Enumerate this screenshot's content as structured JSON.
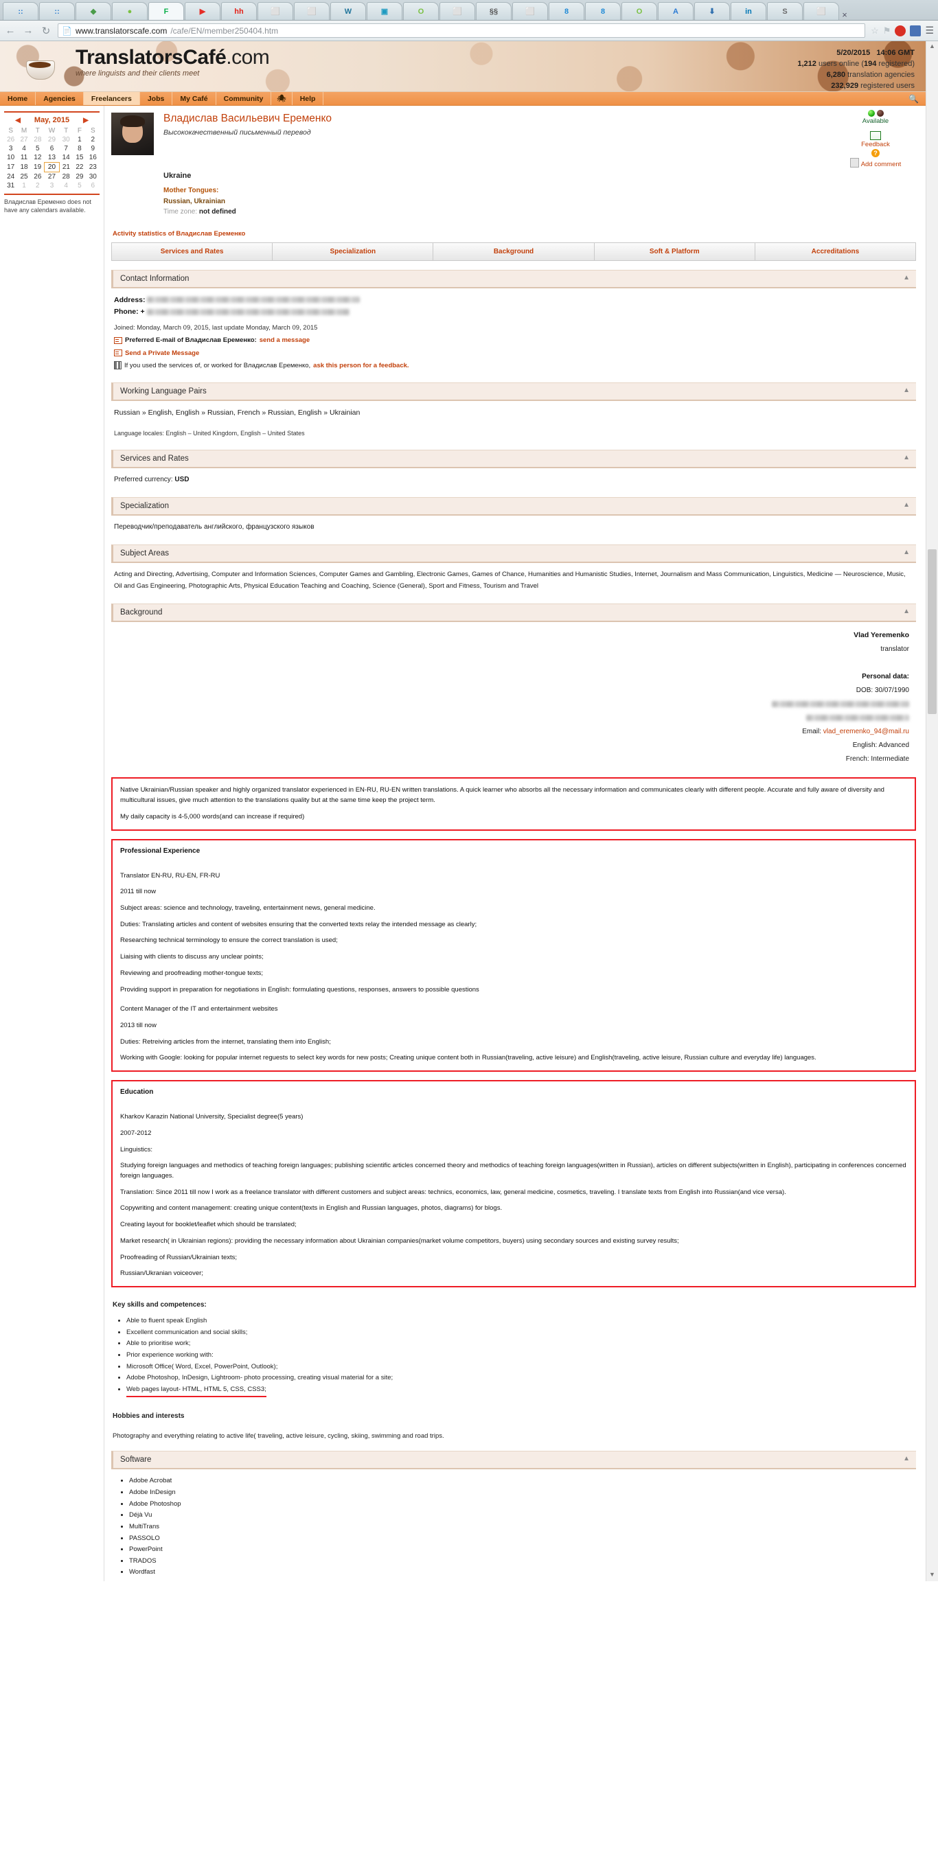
{
  "browser": {
    "url_prefix": "www.translatorscafe.com",
    "url_suffix": "/cafe/EN/member250404.htm",
    "back_icon": "back-arrow-icon",
    "forward_icon": "forward-arrow-icon",
    "reload_icon": "reload-icon",
    "tabs": [
      {
        "glyph": "::",
        "color": "#2f7fd0"
      },
      {
        "glyph": "::",
        "color": "#2f7fd0"
      },
      {
        "glyph": "◆",
        "color": "#4a9c4a"
      },
      {
        "glyph": "●",
        "color": "#7ac143"
      },
      {
        "glyph": "F",
        "color": "#0bb04b"
      },
      {
        "glyph": "▶",
        "color": "#e52d27"
      },
      {
        "glyph": "hh",
        "color": "#e2231a"
      },
      {
        "glyph": "⬜",
        "color": "#9aa7ad"
      },
      {
        "glyph": "⬜",
        "color": "#9aa7ad"
      },
      {
        "glyph": "W",
        "color": "#21759b"
      },
      {
        "glyph": "▣",
        "color": "#1f9bc1"
      },
      {
        "glyph": "O",
        "color": "#7ac143"
      },
      {
        "glyph": "⬜",
        "color": "#9aa7ad"
      },
      {
        "glyph": "§§",
        "color": "#555555"
      },
      {
        "glyph": "⬜",
        "color": "#9aa7ad"
      },
      {
        "glyph": "8",
        "color": "#1f8ad6"
      },
      {
        "glyph": "8",
        "color": "#1f8ad6"
      },
      {
        "glyph": "O",
        "color": "#7ac143"
      },
      {
        "glyph": "A",
        "color": "#2b7bd4"
      },
      {
        "glyph": "⬇",
        "color": "#2f6fae"
      },
      {
        "glyph": "in",
        "color": "#0077b5"
      },
      {
        "glyph": "S",
        "color": "#6a6a6a"
      },
      {
        "glyph": "⬜",
        "color": "#9aa7ad"
      }
    ]
  },
  "site": {
    "logo_main": "TranslatorsCafé",
    "logo_dotcom": ".com",
    "logo_sub": "where linguists and their clients meet",
    "stats": {
      "date": "5/20/2015",
      "time": "14:06 GMT",
      "users_online_count": "1,212",
      "users_online_text": "users online (",
      "registered_count": "194",
      "registered_text": "registered)",
      "agencies_count": "6,280",
      "agencies_text": "translation agencies",
      "members_count": "232,929",
      "members_text": "registered users"
    },
    "nav": [
      {
        "label": "Home",
        "selected": false
      },
      {
        "label": "Agencies",
        "selected": false
      },
      {
        "label": "Freelancers",
        "selected": true
      },
      {
        "label": "Jobs",
        "selected": false
      },
      {
        "label": "My Café",
        "selected": false
      },
      {
        "label": "Community",
        "selected": false
      },
      {
        "label": "Help",
        "selected": false
      }
    ],
    "nav_spider_icon": "spider-icon",
    "search_icon": "search-icon"
  },
  "calendar": {
    "month_label": "May, 2015",
    "prev_icon": "prev-month-arrow",
    "next_icon": "next-month-arrow",
    "weekdays": [
      "S",
      "M",
      "T",
      "W",
      "T",
      "F",
      "S"
    ],
    "weeks": [
      [
        {
          "d": "26",
          "o": true
        },
        {
          "d": "27",
          "o": true
        },
        {
          "d": "28",
          "o": true
        },
        {
          "d": "29",
          "o": true
        },
        {
          "d": "30",
          "o": true
        },
        {
          "d": "1"
        },
        {
          "d": "2"
        }
      ],
      [
        {
          "d": "3"
        },
        {
          "d": "4"
        },
        {
          "d": "5"
        },
        {
          "d": "6"
        },
        {
          "d": "7"
        },
        {
          "d": "8"
        },
        {
          "d": "9"
        }
      ],
      [
        {
          "d": "10"
        },
        {
          "d": "11"
        },
        {
          "d": "12"
        },
        {
          "d": "13"
        },
        {
          "d": "14"
        },
        {
          "d": "15"
        },
        {
          "d": "16"
        }
      ],
      [
        {
          "d": "17"
        },
        {
          "d": "18"
        },
        {
          "d": "19"
        },
        {
          "d": "20",
          "today": true
        },
        {
          "d": "21"
        },
        {
          "d": "22"
        },
        {
          "d": "23"
        }
      ],
      [
        {
          "d": "24"
        },
        {
          "d": "25"
        },
        {
          "d": "26"
        },
        {
          "d": "27"
        },
        {
          "d": "28"
        },
        {
          "d": "29"
        },
        {
          "d": "30"
        }
      ],
      [
        {
          "d": "31"
        },
        {
          "d": "1",
          "o": true
        },
        {
          "d": "2",
          "o": true
        },
        {
          "d": "3",
          "o": true
        },
        {
          "d": "4",
          "o": true
        },
        {
          "d": "5",
          "o": true
        },
        {
          "d": "6",
          "o": true
        }
      ]
    ],
    "note": "Владислав Еременко does not have any calendars available."
  },
  "profile": {
    "name": "Владислав Васильевич Еременко",
    "tagline": "Высококачественный письменный перевод",
    "country": "Ukraine",
    "mother_tongues_label": "Mother Tongues:",
    "mother_tongues_value": "Russian, Ukrainian",
    "timezone_label": "Time zone:",
    "timezone_value": "not defined",
    "avatar_icon": "profile-photo",
    "status_label": "Available",
    "feedback_label": "Feedback",
    "add_comment_label": "Add comment",
    "activity_stats": "Activity statistics of Владислав Еременко"
  },
  "tabs": [
    {
      "label": "Services and Rates"
    },
    {
      "label": "Specialization"
    },
    {
      "label": "Background"
    },
    {
      "label": "Soft & Platform"
    },
    {
      "label": "Accreditations"
    }
  ],
  "contact": {
    "panel_title": "Contact Information",
    "address_label": "Address:",
    "phone_label": "Phone: +",
    "joined": "Joined: Monday, March 09, 2015, last update Monday, March 09, 2015",
    "preferred_email_text": "Preferred E-mail of Владислав Еременко:",
    "send_message_link": "send a message",
    "private_message_link": "Send a Private Message",
    "feedback_text": "If you used the services of, or worked for Владислав Еременко,",
    "feedback_link": "ask this person for a feedback."
  },
  "language_pairs": {
    "panel_title": "Working Language Pairs",
    "pairs": "Russian » English, English » Russian, French » Russian, English » Ukrainian",
    "locales": "Language locales: English – United Kingdom, English – United States"
  },
  "services": {
    "panel_title": "Services and Rates",
    "currency_label": "Preferred currency:",
    "currency_value": "USD"
  },
  "specialization": {
    "panel_title": "Specialization",
    "text": "Переводчик/преподаватель английского, французского языков"
  },
  "subject_areas": {
    "panel_title": "Subject Areas",
    "text": "Acting and Directing, Advertising, Computer and Information Sciences, Computer Games and Gambling, Electronic Games, Games of Chance, Humanities and Humanistic Studies, Internet, Journalism and Mass Communication, Linguistics, Medicine — Neuroscience, Music, Oil and Gas Engineering, Photographic Arts, Physical Education Teaching and Coaching, Science (General), Sport and Fitness, Tourism and Travel"
  },
  "background": {
    "panel_title": "Background",
    "name": "Vlad Yeremenko",
    "role": "translator",
    "personal_data_label": "Personal data:",
    "dob": "DOB: 30/07/1990",
    "email_label": "Email:",
    "email_value": "vlad_eremenko_94@mail.ru",
    "english_level": "English: Advanced",
    "french_level": "French: Intermediate"
  },
  "summary": {
    "para1": "Native Ukrainian/Russian speaker and highly organized translator experienced in EN-RU, RU-EN written translations. A quick learner who absorbs all the necessary information and communicates clearly with different people. Accurate and fully aware of diversity and multicultural issues, give much attention to the translations quality but at the same time keep the project term.",
    "para2": "My daily capacity is 4-5,000 words(and can increase if required)"
  },
  "experience": {
    "title": "Professional Experience",
    "job1_role": "Translator  EN-RU, RU-EN, FR-RU",
    "job1_years": "2011 till now",
    "job1_lines": [
      "Subject areas: science and technology, traveling, entertainment news, general      medicine.",
      "Duties: Translating articles and content of websites ensuring that the converted texts   relay the intended message as clearly;",
      "Researching technical terminology to ensure the correct translation is used;",
      "Liaising with clients to discuss any unclear points;",
      "Reviewing and proofreading mother-tongue texts;",
      "Providing support in preparation for negotiations in English: formulating questions, responses, answers to possible questions"
    ],
    "job2_role": "Content Manager of the IT and entertainment websites",
    "job2_years": "2013 till now",
    "job2_lines": [
      "Duties: Retreiving articles from the internet, translating them into English;",
      "Working with Google: looking for popular internet reguests to select key words for new posts; Creating unique content both in Russian(traveling, active leisure) and English(traveling, active leisure, Russian culture and everyday life) languages."
    ]
  },
  "education": {
    "title": "Education",
    "school": "Kharkov Karazin National University, Specialist degree(5 years)",
    "years": "2007-2012",
    "lines": [
      "Linguistics:",
      "Studying foreign languages and methodics of teaching foreign languages; publishing scientific articles concerned theory and methodics of teaching foreign languages(written in Russian), articles on different subjects(written in English), participating in conferences concerned foreign languages.",
      "Translation: Since 2011 till now I work as a freelance translator with different customers and subject areas: technics, economics, law, general medicine, cosmetics, traveling. I translate texts from English into Russian(and vice versa).",
      "Copywriting and content management: creating unique content(texts in English and Russian languages, photos, diagrams) for blogs.",
      "Creating layout for booklet/leaflet which should be translated;",
      "Market research( in Ukrainian regions): providing the necessary information about Ukrainian companies(market volume competitors, buyers) using secondary sources and existing survey results;",
      "Proofreading of Russian/Ukrainian texts;",
      "Russian/Ukranian voiceover;"
    ]
  },
  "skills": {
    "title": "Key skills and competences:",
    "items": [
      {
        "text": "Able to fluent speak English",
        "underline": false
      },
      {
        "text": "Excellent communication and social skills;",
        "underline": false
      },
      {
        "text": "Able to prioritise work;",
        "underline": false
      },
      {
        "text": "Prior experience working with:",
        "underline": false
      },
      {
        "text": "Microsoft Office( Word, Excel, PowerPoint, Outlook);",
        "underline": false
      },
      {
        "text": "Adobe Photoshop, InDesign, Lightroom- photo processing, creating visual material for a site;",
        "underline": false
      },
      {
        "text": "Web pages layout- HTML, HTML 5, CSS, CSS3;",
        "underline": true
      }
    ]
  },
  "hobbies": {
    "title": "Hobbies and interests",
    "text": "Photography and everything relating to active life( traveling, active leisure, cycling, skiing, swimming and road trips."
  },
  "software": {
    "panel_title": "Software",
    "items": [
      "Adobe Acrobat",
      "Adobe InDesign",
      "Adobe Photoshop",
      "Déjà Vu",
      "MultiTrans",
      "PASSOLO",
      "PowerPoint",
      "TRADOS",
      "Wordfast"
    ]
  }
}
